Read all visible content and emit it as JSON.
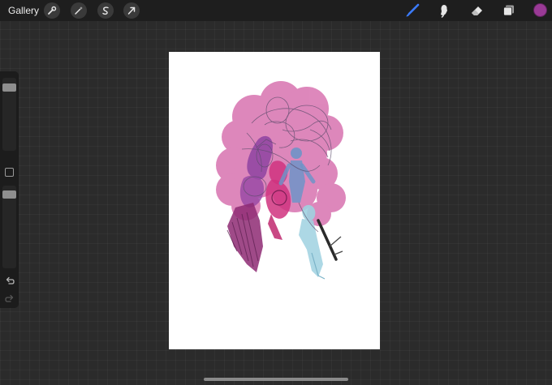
{
  "app": {
    "gallery_label": "Gallery"
  },
  "toolbar": {
    "actions": [
      {
        "name": "actions-wrench",
        "icon": "wrench-icon"
      },
      {
        "name": "adjustments",
        "icon": "magic-wand-icon"
      },
      {
        "name": "selection",
        "icon": "selection-s-icon"
      },
      {
        "name": "transform",
        "icon": "cursor-arrow-icon"
      }
    ],
    "tools": [
      {
        "name": "brush",
        "icon": "brush-icon",
        "active": true
      },
      {
        "name": "smudge",
        "icon": "smudge-icon",
        "active": false
      },
      {
        "name": "eraser",
        "icon": "eraser-icon",
        "active": false
      },
      {
        "name": "layers",
        "icon": "layers-icon",
        "active": false
      }
    ],
    "current_color": "#9a3a96",
    "active_tool_color": "#3b7bff"
  },
  "sidebar": {
    "brush_size_level": 0.9,
    "opacity_level": 0.96,
    "icons": [
      "modify-square-icon",
      "undo-icon",
      "redo-icon"
    ]
  },
  "canvas": {
    "background": "#ffffff",
    "colors": {
      "pink_cloud": "#d873b0",
      "magenta": "#d0337f",
      "purple": "#8a3fa0",
      "dark_magenta": "#8e2a73",
      "blue": "#6f94c8",
      "light_blue": "#9fd1e0",
      "sketch_line": "#5b4b6b"
    }
  }
}
